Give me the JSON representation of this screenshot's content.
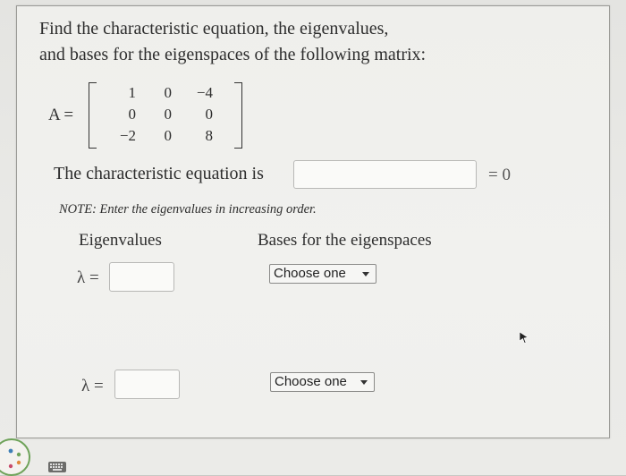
{
  "question": {
    "line1": "Find the characteristic equation, the eigenvalues,",
    "line2": "and bases for the eigenspaces of the following matrix:"
  },
  "matrix": {
    "label": "A =",
    "rows": [
      [
        "1",
        "0",
        "−4"
      ],
      [
        "0",
        "0",
        "0"
      ],
      [
        "−2",
        "0",
        "8"
      ]
    ]
  },
  "characteristic": {
    "label": "The characteristic equation is",
    "value": "",
    "suffix": "= 0"
  },
  "note": "NOTE: Enter the eigenvalues in increasing order.",
  "columns": {
    "eigenvalues": "Eigenvalues",
    "bases": "Bases for the eigenspaces"
  },
  "eigen_rows": [
    {
      "lambda_label": "λ =",
      "value": "",
      "select_value": "Choose one"
    },
    {
      "lambda_label": "λ =",
      "value": "",
      "select_value": "Choose one"
    }
  ],
  "icons": {
    "cursor": "mouse-pointer-icon",
    "badge": "palette-icon",
    "keyboard": "keyboard-icon"
  }
}
